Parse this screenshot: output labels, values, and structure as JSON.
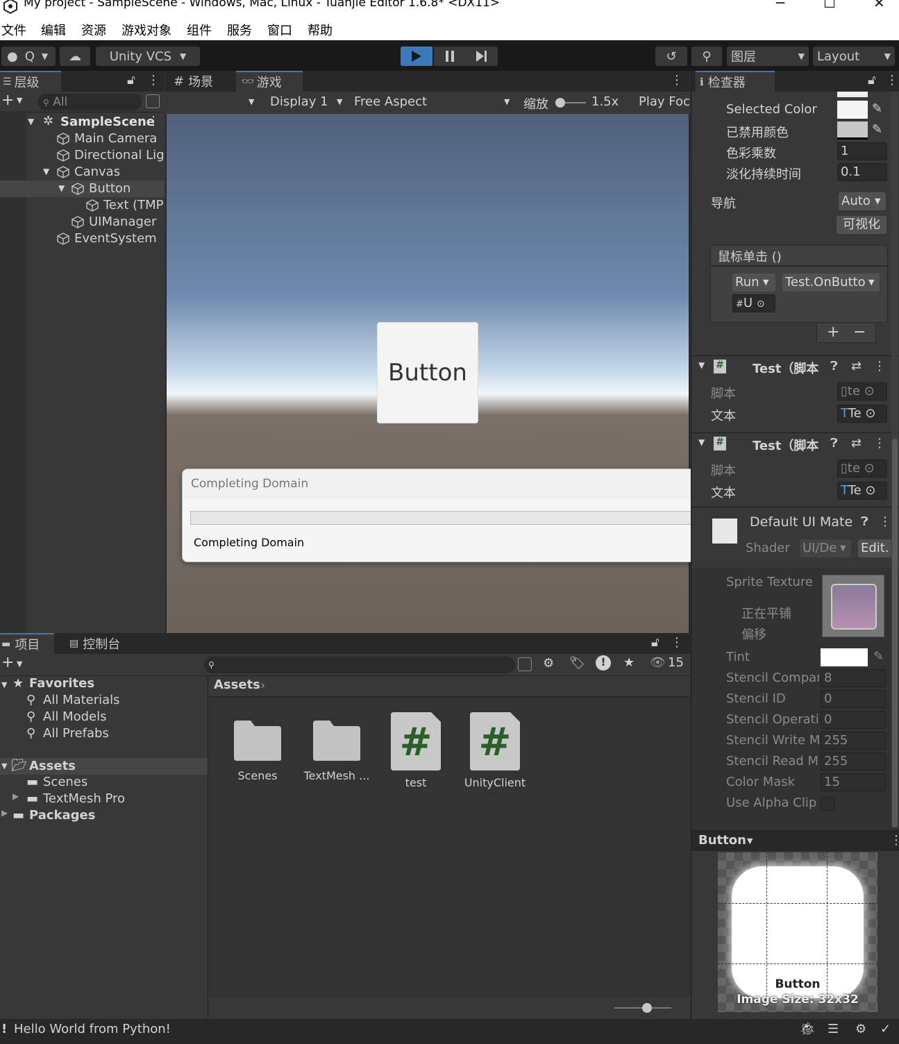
{
  "window": {
    "title": "My project - SampleScene - Windows, Mac, Linux - Tuanjie Editor 1.6.8* <DX11>"
  },
  "menu": [
    "文件",
    "编辑",
    "资源",
    "游戏对象",
    "组件",
    "服务",
    "窗口",
    "帮助"
  ],
  "toolbar": {
    "account_label": "Q",
    "vcs_label": "Unity VCS",
    "layers_label": "图层",
    "layout_label": "Layout"
  },
  "hierarchy": {
    "tab": "层级",
    "search_placeholder": "All",
    "items": [
      "SampleScene",
      "Main Camera",
      "Directional Lig",
      "Canvas",
      "Button",
      "Text (TMP",
      "UIManager",
      "EventSystem"
    ]
  },
  "scene_tab": "场景",
  "game": {
    "tab": "游戏",
    "display": "Display 1",
    "aspect": "Free Aspect",
    "scale_label": "缩放",
    "scale_value": "1.5x",
    "play_focus": "Play Foc",
    "button_text": "Button"
  },
  "dialog": {
    "title": "Completing Domain",
    "message": "Completing Domain",
    "progress": 0
  },
  "inspector": {
    "tab": "检查器",
    "selected_color_label": "Selected Color",
    "disabled_color_label": "已禁用颜色",
    "color_multiplier_label": "色彩乘数",
    "color_multiplier_value": "1",
    "fade_duration_label": "淡化持续时间",
    "fade_duration_value": "0.1",
    "navigation_label": "导航",
    "navigation_value": "Auto",
    "visualize_button": "可视化",
    "onclick_header": "鼠标单击 ()",
    "runtime_value": "Run",
    "function_value": "Test.OnButto",
    "object_value": "U",
    "component1": {
      "title": "Test（脚本",
      "script_label": "脚本",
      "script_value": "te",
      "text_label": "文本",
      "text_value": "Te"
    },
    "component2": {
      "title": "Test（脚本",
      "script_label": "脚本",
      "script_value": "te",
      "text_label": "文本",
      "text_value": "Te"
    },
    "material": {
      "title": "Default UI Mate",
      "shader_label": "Shader",
      "shader_value": "UI/De",
      "edit_button": "Edit.",
      "sprite_texture_label": "Sprite Texture",
      "tiling_label": "正在平铺",
      "offset_label": "偏移",
      "tint_label": "Tint",
      "props": [
        {
          "label": "Stencil Compar",
          "value": "8"
        },
        {
          "label": "Stencil ID",
          "value": "0"
        },
        {
          "label": "Stencil Operati",
          "value": "0"
        },
        {
          "label": "Stencil Write M",
          "value": "255"
        },
        {
          "label": "Stencil Read M",
          "value": "255"
        },
        {
          "label": "Color Mask",
          "value": "15"
        }
      ],
      "use_alpha_clip_label": "Use Alpha Clip"
    },
    "preview": {
      "title": "Button",
      "name": "Button",
      "size": "Image Size: 32x32"
    }
  },
  "project": {
    "tab": "项目",
    "console_tab": "控制台",
    "hidden_count": "15",
    "favorites_label": "Favorites",
    "favorites": [
      "All Materials",
      "All Models",
      "All Prefabs"
    ],
    "assets_label": "Assets",
    "asset_children": [
      "Scenes",
      "TextMesh Pro"
    ],
    "packages_label": "Packages",
    "breadcrumb": "Assets",
    "items": [
      {
        "name": "Scenes",
        "kind": "folder"
      },
      {
        "name": "TextMesh ...",
        "kind": "folder"
      },
      {
        "name": "test",
        "kind": "script"
      },
      {
        "name": "UnityClient",
        "kind": "script"
      }
    ]
  },
  "status": {
    "message": "Hello World from Python!"
  },
  "colors": {
    "accent": "#3a79bb",
    "play_active": "#3a79bb",
    "script_hash": "#2a5f2a"
  }
}
